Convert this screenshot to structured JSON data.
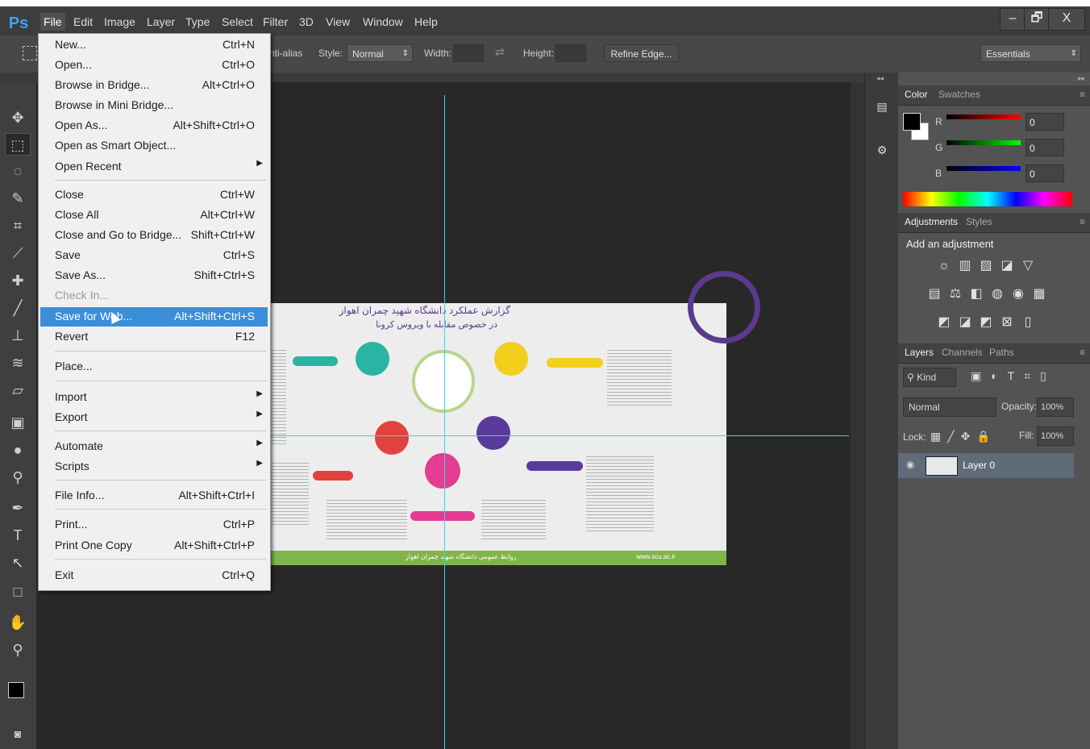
{
  "app": {
    "logo": "Ps"
  },
  "menubar": {
    "items": [
      "File",
      "Edit",
      "Image",
      "Layer",
      "Type",
      "Select",
      "Filter",
      "3D",
      "View",
      "Window",
      "Help"
    ],
    "window_buttons": [
      "–",
      "🗗",
      "X"
    ]
  },
  "options_bar": {
    "antialias_label": "nti-alias",
    "style_label": "Style:",
    "style_value": "Normal",
    "width_label": "Width:",
    "height_label": "Height:",
    "refine_edge": "Refine Edge...",
    "workspace": "Essentials"
  },
  "file_menu": {
    "items": [
      {
        "label": "New...",
        "shortcut": "Ctrl+N"
      },
      {
        "label": "Open...",
        "shortcut": "Ctrl+O"
      },
      {
        "label": "Browse in Bridge...",
        "shortcut": "Alt+Ctrl+O"
      },
      {
        "label": "Browse in Mini Bridge...",
        "shortcut": ""
      },
      {
        "label": "Open As...",
        "shortcut": "Alt+Shift+Ctrl+O"
      },
      {
        "label": "Open as Smart Object...",
        "shortcut": ""
      },
      {
        "label": "Open Recent",
        "shortcut": ""
      },
      {
        "label": "Close",
        "shortcut": "Ctrl+W"
      },
      {
        "label": "Close All",
        "shortcut": "Alt+Ctrl+W"
      },
      {
        "label": "Close and Go to Bridge...",
        "shortcut": "Shift+Ctrl+W"
      },
      {
        "label": "Save",
        "shortcut": "Ctrl+S"
      },
      {
        "label": "Save As...",
        "shortcut": "Shift+Ctrl+S"
      },
      {
        "label": "Check In...",
        "shortcut": ""
      },
      {
        "label": "Save for Web...",
        "shortcut": "Alt+Shift+Ctrl+S"
      },
      {
        "label": "Revert",
        "shortcut": "F12"
      },
      {
        "label": "Place...",
        "shortcut": ""
      },
      {
        "label": "Import",
        "shortcut": ""
      },
      {
        "label": "Export",
        "shortcut": ""
      },
      {
        "label": "Automate",
        "shortcut": ""
      },
      {
        "label": "Scripts",
        "shortcut": ""
      },
      {
        "label": "File Info...",
        "shortcut": "Alt+Shift+Ctrl+I"
      },
      {
        "label": "Print...",
        "shortcut": "Ctrl+P"
      },
      {
        "label": "Print One Copy",
        "shortcut": "Alt+Shift+Ctrl+P"
      },
      {
        "label": "Exit",
        "shortcut": "Ctrl+Q"
      }
    ],
    "highlighted": "Save for Web...",
    "disabled": "Check In..."
  },
  "color_panel": {
    "tabs": [
      "Color",
      "Swatches"
    ],
    "channels": [
      {
        "name": "R",
        "value": "0"
      },
      {
        "name": "G",
        "value": "0"
      },
      {
        "name": "B",
        "value": "0"
      }
    ]
  },
  "adjustments_panel": {
    "tabs": [
      "Adjustments",
      "Styles"
    ],
    "heading": "Add an adjustment"
  },
  "layers_panel": {
    "tabs": [
      "Layers",
      "Channels",
      "Paths"
    ],
    "filter_kind": "Kind",
    "blend_mode": "Normal",
    "opacity_label": "Opacity:",
    "opacity_value": "100%",
    "lock_label": "Lock:",
    "fill_label": "Fill:",
    "fill_value": "100%",
    "layers": [
      {
        "name": "Layer 0"
      }
    ]
  },
  "document": {
    "title_line1": "گزارش عملکرد دانشگاه شهید چمران اهواز",
    "title_line2": "در خصوص مقابله با ویروس کرونا",
    "footer_left": "روابط عمومی دانشگاه شهید چمران اهواز",
    "footer_right": "www.scu.ac.ir"
  },
  "colors": {
    "menu_highlight": "#3b8fd9",
    "guide": "#3fd3e0",
    "doc_footer": "#7fb54a",
    "accent_purple": "#5b3a8f"
  }
}
